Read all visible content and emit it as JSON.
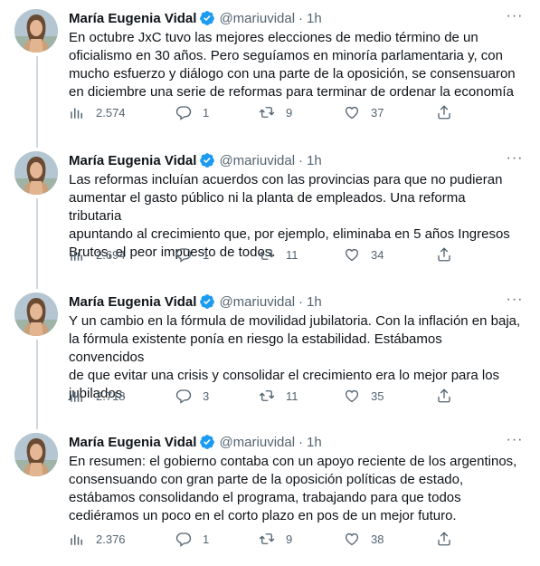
{
  "author": {
    "name": "María Eugenia Vidal",
    "handle": "@mariuvidal",
    "dot": "·",
    "time": "1h"
  },
  "more_label": "···",
  "tweets": [
    {
      "text": "En octubre JxC tuvo las mejores elecciones de medio término de un\noficialismo en 30 años. Pero seguíamos en minoría parlamentaria y, con\nmucho esfuerzo y diálogo con una parte de la oposición, se consensuaron\nen diciembre una serie de reformas para terminar de ordenar la economía",
      "views": "2.574",
      "replies": "1",
      "retweets": "9",
      "likes": "37"
    },
    {
      "text": "Las reformas incluían acuerdos con las provincias para que no pudieran\naumentar el gasto público ni la planta de empleados. Una reforma tributaria\napuntando al crecimiento que, por ejemplo,  eliminaba en 5 años Ingresos\nBrutos, el peor impuesto de todos.",
      "views": "2.694",
      "replies": "1",
      "retweets": "11",
      "likes": "34"
    },
    {
      "text": "Y un cambio en la fórmula de movilidad jubilatoria. Con la inflación en baja,\nla fórmula existente ponía en riesgo la estabilidad. Estábamos convencidos\nde que evitar una crisis y consolidar el crecimiento era lo mejor para los\njubilados.",
      "views": "2.718",
      "replies": "3",
      "retweets": "11",
      "likes": "35"
    },
    {
      "text": "En resumen: el gobierno contaba con un apoyo reciente de los argentinos,\nconsensuando con gran parte de la oposición políticas de estado,\nestábamos consolidando el programa, trabajando para que todos\ncediéramos un poco en el corto plazo en pos de un mejor futuro.",
      "views": "2.376",
      "replies": "1",
      "retweets": "9",
      "likes": "38"
    }
  ],
  "icons": {
    "views": "bar-chart-icon",
    "reply": "speech-bubble-icon",
    "retweet": "retweet-icon",
    "like": "heart-icon",
    "share": "share-icon",
    "verified": "verified-badge-icon"
  },
  "colors": {
    "text": "#0f1419",
    "secondary": "#536471",
    "verified": "#1d9bf0",
    "thread_line": "#cfd9de"
  }
}
